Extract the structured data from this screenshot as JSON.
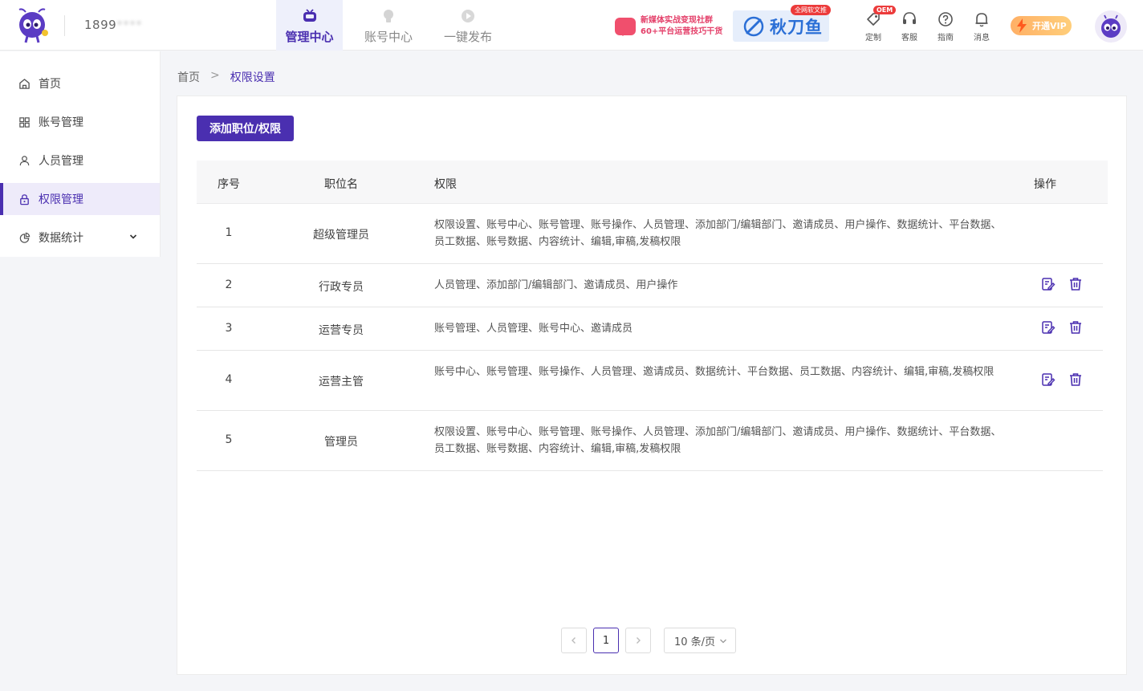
{
  "header": {
    "phone_visible": "1899",
    "phone_masked": "****",
    "tabs": [
      {
        "label": "管理中心",
        "active": true,
        "icon": "tv-icon"
      },
      {
        "label": "账号中心",
        "active": false,
        "icon": "bulb-icon"
      },
      {
        "label": "一键发布",
        "active": false,
        "icon": "play-icon"
      }
    ],
    "community_banner": {
      "line1": "新媒体实战变现社群",
      "line2": "60+平台运营技巧干货"
    },
    "qiudao_banner": {
      "name": "秋刀鱼",
      "badge": "全网软文推"
    },
    "tools": [
      {
        "label": "定制",
        "icon": "tag-icon",
        "badge": "OEM"
      },
      {
        "label": "客服",
        "icon": "headset-icon"
      },
      {
        "label": "指南",
        "icon": "help-icon"
      },
      {
        "label": "消息",
        "icon": "bell-icon"
      }
    ],
    "vip_label": "开通VIP"
  },
  "sidebar": {
    "items": [
      {
        "label": "首页",
        "icon": "home-icon",
        "active": false
      },
      {
        "label": "账号管理",
        "icon": "grid-icon",
        "active": false
      },
      {
        "label": "人员管理",
        "icon": "user-icon",
        "active": false
      },
      {
        "label": "权限管理",
        "icon": "lock-icon",
        "active": true
      },
      {
        "label": "数据统计",
        "icon": "chart-icon",
        "active": false,
        "expandable": true
      }
    ]
  },
  "breadcrumb": {
    "home": "首页",
    "separator": ">",
    "current": "权限设置"
  },
  "main": {
    "add_button": "添加职位/权限",
    "columns": [
      "序号",
      "职位名",
      "权限",
      "操作"
    ],
    "rows": [
      {
        "index": "1",
        "name": "超级管理员",
        "permissions": "权限设置、账号中心、账号管理、账号操作、人员管理、添加部门/编辑部门、邀请成员、用户操作、数据统计、平台数据、员工数据、账号数据、内容统计、编辑,审稿,发稿权限",
        "editable": false
      },
      {
        "index": "2",
        "name": "行政专员",
        "permissions": "人员管理、添加部门/编辑部门、邀请成员、用户操作",
        "editable": true
      },
      {
        "index": "3",
        "name": "运营专员",
        "permissions": "账号管理、人员管理、账号中心、邀请成员",
        "editable": true
      },
      {
        "index": "4",
        "name": "运营主管",
        "permissions": "账号中心、账号管理、账号操作、人员管理、邀请成员、数据统计、平台数据、员工数据、内容统计、编辑,审稿,发稿权限",
        "editable": true
      },
      {
        "index": "5",
        "name": "管理员",
        "permissions": "权限设置、账号中心、账号管理、账号操作、人员管理、添加部门/编辑部门、邀请成员、用户操作、数据统计、平台数据、员工数据、账号数据、内容统计、编辑,审稿,发稿权限",
        "editable": false
      }
    ]
  },
  "pagination": {
    "current_page": "1",
    "page_size": "10 条/页"
  },
  "colors": {
    "accent": "#4a2fb0",
    "badge_red": "#ec3b3b",
    "vip_orange": "#ffb066"
  }
}
